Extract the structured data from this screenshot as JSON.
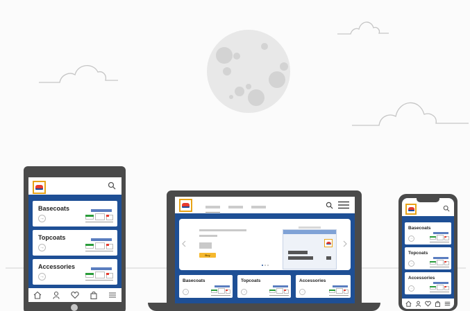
{
  "categories": {
    "basecoats": "Basecoats",
    "topcoats": "Topcoats",
    "accessories": "Accessories"
  },
  "hero": {
    "cta_label": "Buy"
  },
  "icons": {
    "search": "search-icon",
    "menu": "hamburger-menu-icon",
    "arrow": "arrow-right-circle-icon",
    "home": "home-icon",
    "user": "user-icon",
    "heart": "heart-icon",
    "bag": "shopping-bag-icon",
    "chevron_left": "chevron-left-icon",
    "chevron_right": "chevron-right-icon"
  },
  "colors": {
    "brand_blue": "#1e4f95",
    "device_frame": "#4a4a4a",
    "accent_yellow": "#f5b82e",
    "logo_red": "#e63b2e",
    "moon": "#e7e7e7",
    "moon_crater": "#cfcfcf",
    "cloud_line": "#c5c5c5"
  }
}
